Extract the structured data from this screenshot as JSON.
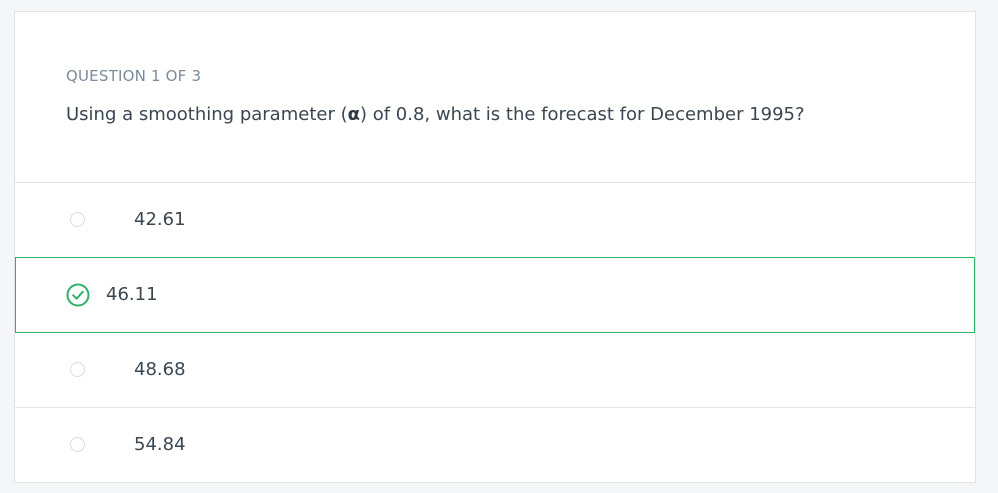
{
  "question": {
    "counter": "QUESTION 1 OF 3",
    "text_before": "Using a smoothing parameter (",
    "symbol": "α",
    "text_after": ") of 0.8, what is the forecast for December 1995?"
  },
  "answers": [
    {
      "label": "42.61",
      "state": "unselected"
    },
    {
      "label": "46.11",
      "state": "correct"
    },
    {
      "label": "48.68",
      "state": "unselected"
    },
    {
      "label": "54.84",
      "state": "unselected"
    }
  ],
  "colors": {
    "correct": "#2fae6a",
    "text": "#3b4650",
    "counter": "#7b8b99"
  }
}
